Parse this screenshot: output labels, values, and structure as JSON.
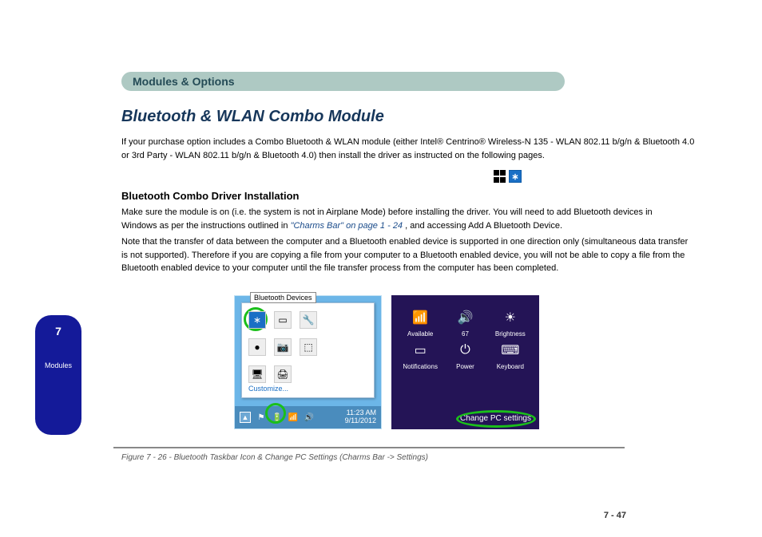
{
  "header": {
    "title": "Modules & Options"
  },
  "main_title": "Bluetooth & WLAN Combo Module",
  "intro_text": "If your purchase option includes a Combo Bluetooth & WLAN module (either Intel® Centrino® Wireless-N 135 - WLAN 802.11 b/g/n & Bluetooth 4.0 or 3rd Party - WLAN 802.11 b/g/n & Bluetooth 4.0) then install the driver as instructed on the following pages.",
  "setup_heading": "Bluetooth Combo Driver Installation",
  "para2_text": "Make sure the module is on (i.e. the system is not in Airplane Mode) before installing the driver. You will need to add Bluetooth devices in Windows as per the instructions outlined in",
  "link_inline": "\"Charms Bar\" on page 1 - 24",
  "para2_tail": ", and accessing Add A Bluetooth Device.",
  "para3_text": "Note that the transfer of data between the computer and a Bluetooth enabled device is supported in one direction only (simultaneous data transfer is not supported). Therefore if you are copying a file from your computer to a Bluetooth enabled device, you will not be able to copy a file from the Bluetooth enabled device to your computer until the file transfer process from the computer has been completed.",
  "side_tab": {
    "num": "7",
    "label": "Modules"
  },
  "shot1": {
    "tooltip": "Bluetooth Devices",
    "customize": "Customize...",
    "time": "11:23 AM",
    "date": "9/11/2012"
  },
  "shot2": {
    "items": [
      {
        "label": "Available",
        "value": ""
      },
      {
        "label": "67",
        "value": ""
      },
      {
        "label": "Brightness",
        "value": ""
      },
      {
        "label": "Notifications",
        "value": ""
      },
      {
        "label": "Power",
        "value": ""
      },
      {
        "label": "Keyboard",
        "value": ""
      }
    ],
    "change_link": "Change PC settings"
  },
  "caption": "Figure 7 - 26 - Bluetooth Taskbar Icon & Change PC Settings (Charms Bar -> Settings)",
  "page_number": "7 - 47"
}
